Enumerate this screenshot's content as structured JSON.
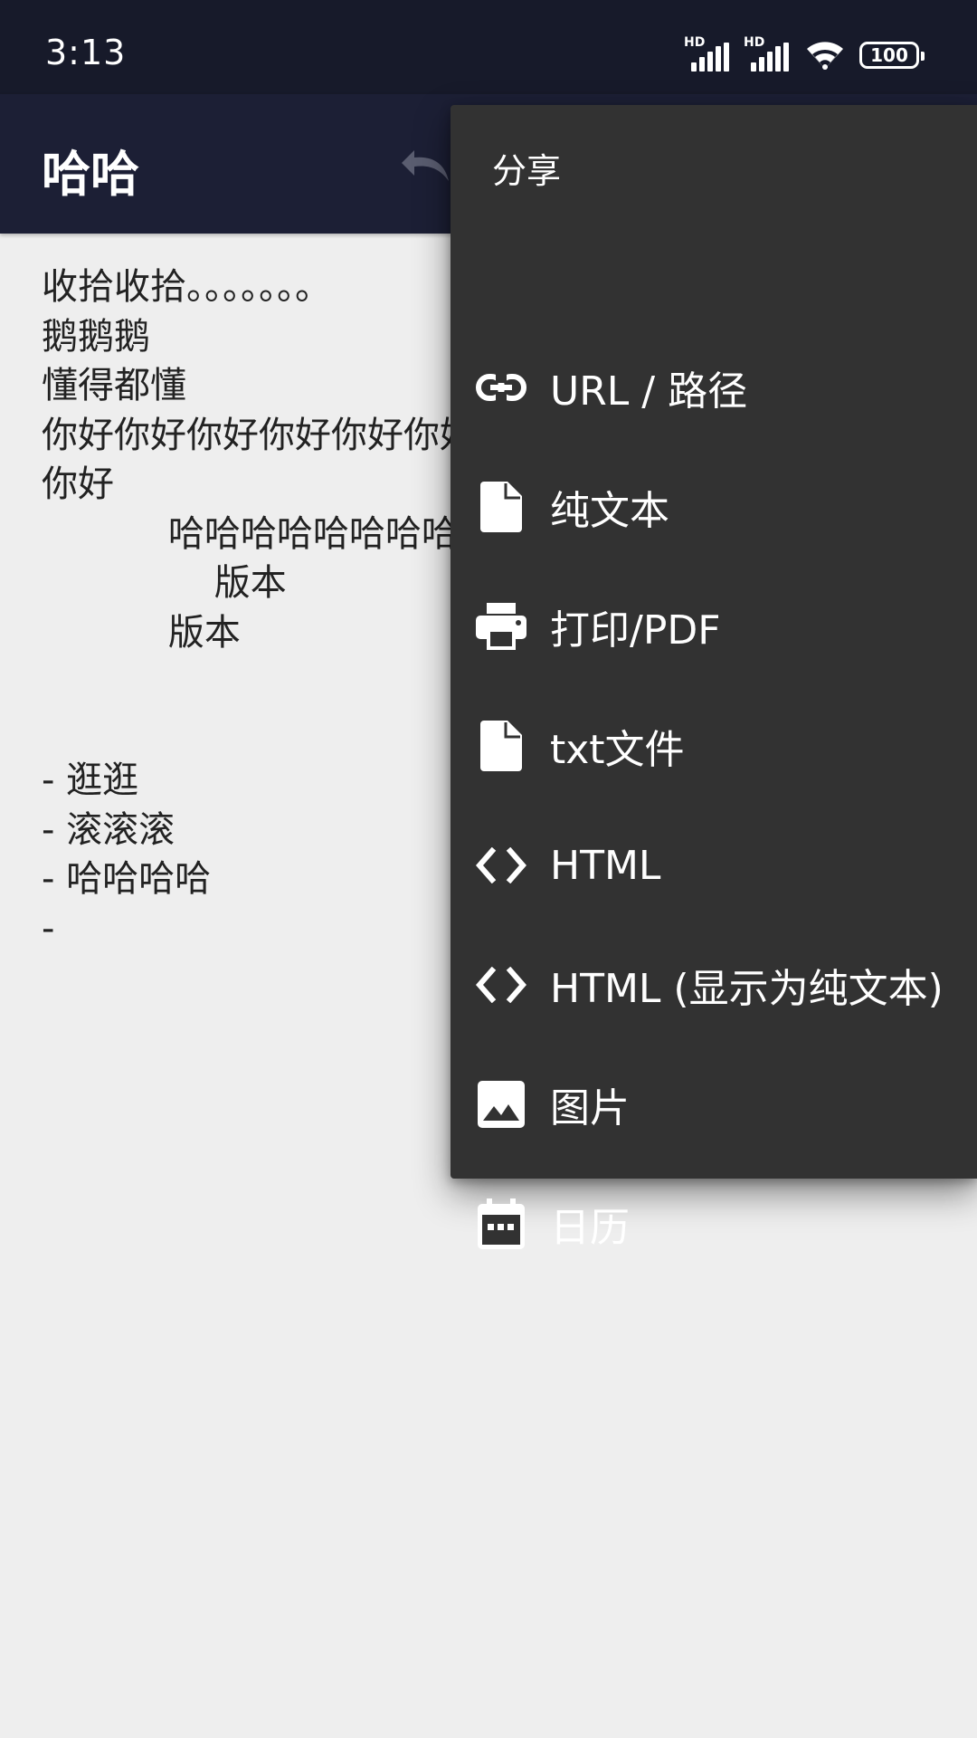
{
  "status_bar": {
    "time": "3:13",
    "signal_labels": [
      "HD",
      "HD"
    ],
    "battery": "100",
    "icons": [
      "signal-icon",
      "signal-icon",
      "wifi-icon",
      "battery-icon"
    ]
  },
  "app_bar": {
    "title": "哈哈",
    "undo_icon": "undo-icon"
  },
  "editor": {
    "lines": [
      "收拾收拾。。。。。。。",
      "鹅鹅鹅",
      "懂得都懂",
      "你好你好你好你好你好你好",
      "你好",
      "           哈哈哈哈哈哈哈哈",
      "               版本",
      "           版本",
      "",
      "",
      "- 逛逛",
      "- 滚滚滚",
      "- 哈哈哈哈",
      "-"
    ]
  },
  "share_menu": {
    "header": "分享",
    "items": [
      {
        "label": "URL / 路径",
        "icon": "link-icon"
      },
      {
        "label": "纯文本",
        "icon": "file-icon"
      },
      {
        "label": "打印/PDF",
        "icon": "print-icon"
      },
      {
        "label": "txt文件",
        "icon": "file-icon"
      },
      {
        "label": "HTML",
        "icon": "code-icon"
      },
      {
        "label": "HTML (显示为纯文本)",
        "icon": "code-icon"
      },
      {
        "label": "图片",
        "icon": "image-icon"
      },
      {
        "label": "日历",
        "icon": "calendar-icon"
      }
    ]
  },
  "colors": {
    "status_bar_bg": "#171a2a",
    "app_bar_bg": "#1c1f35",
    "content_bg": "#eeeeee",
    "menu_bg": "#323232"
  }
}
